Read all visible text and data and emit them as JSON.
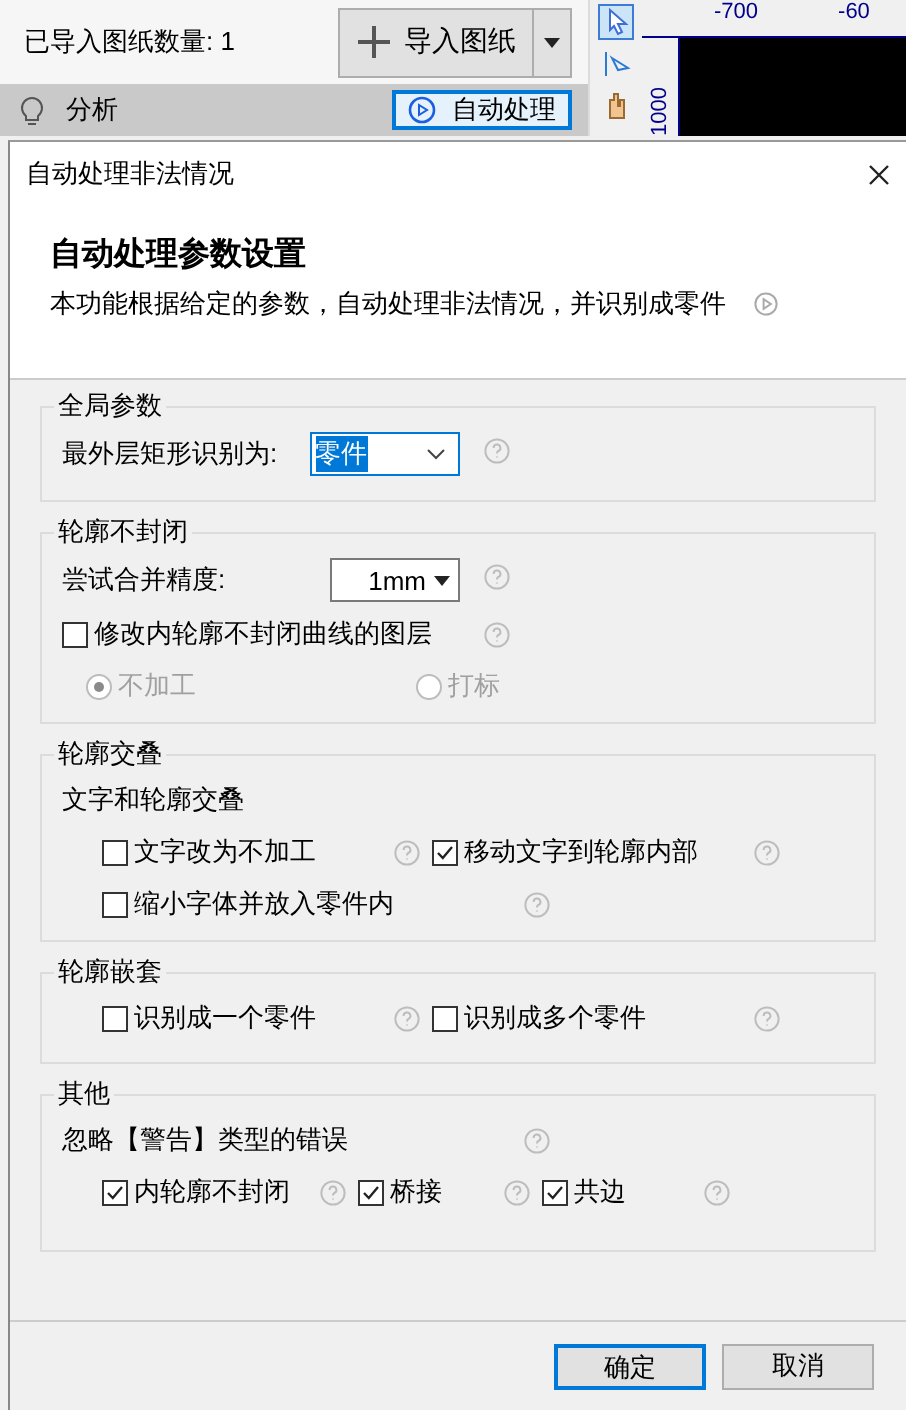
{
  "app": {
    "count_label": "已导入图纸数量: 1",
    "import_button": "导入图纸",
    "analysis_label": "分析",
    "auto_button": "自动处理",
    "ruler_x_labels": [
      "-700",
      "-60"
    ],
    "ruler_y_label": "1000"
  },
  "dialog": {
    "title": "自动处理非法情况",
    "heading": "自动处理参数设置",
    "description": "本功能根据给定的参数，自动处理非法情况，并识别成零件",
    "groups": [
      {
        "title": "全局参数",
        "rows": [
          {
            "kind": "single",
            "items": [
              {
                "kind": "select",
                "label": "最外层矩形识别为:",
                "value": "零件",
                "help": true
              }
            ]
          }
        ]
      },
      {
        "title": "轮廓不封闭",
        "rows": [
          {
            "kind": "single",
            "items": [
              {
                "kind": "combo",
                "label": "尝试合并精度:",
                "value": "1mm",
                "help": true
              }
            ]
          },
          {
            "kind": "single",
            "items": [
              {
                "kind": "checkbox",
                "label": "修改内轮廓不封闭曲线的图层",
                "checked": false,
                "help": true
              }
            ]
          },
          {
            "kind": "pair",
            "items": [
              {
                "kind": "radio",
                "label": "不加工",
                "selected": true,
                "disabled": true,
                "help": false
              },
              {
                "kind": "radio",
                "label": "打标",
                "selected": false,
                "disabled": true,
                "help": false
              }
            ]
          }
        ]
      },
      {
        "title": "轮廓交叠",
        "rows": [
          {
            "kind": "single",
            "items": [
              {
                "kind": "subheading",
                "label": "文字和轮廓交叠",
                "help": false
              }
            ]
          },
          {
            "kind": "pair",
            "items": [
              {
                "kind": "checkbox",
                "label": "文字改为不加工",
                "checked": false,
                "help": true
              },
              {
                "kind": "checkbox",
                "label": "移动文字到轮廓内部",
                "checked": true,
                "help": true
              }
            ]
          },
          {
            "kind": "single",
            "items": [
              {
                "kind": "checkbox",
                "label": "缩小字体并放入零件内",
                "checked": false,
                "help": true
              }
            ]
          }
        ]
      },
      {
        "title": "轮廓嵌套",
        "rows": [
          {
            "kind": "pair",
            "items": [
              {
                "kind": "checkbox",
                "label": "识别成一个零件",
                "checked": false,
                "help": true
              },
              {
                "kind": "checkbox",
                "label": "识别成多个零件",
                "checked": false,
                "help": true
              }
            ]
          }
        ]
      },
      {
        "title": "其他",
        "rows": [
          {
            "kind": "single",
            "items": [
              {
                "kind": "subheading",
                "label": "忽略【警告】类型的错误",
                "help": true
              }
            ]
          },
          {
            "kind": "triple",
            "items": [
              {
                "kind": "checkbox",
                "label": "内轮廓不封闭",
                "checked": true,
                "help": true
              },
              {
                "kind": "checkbox",
                "label": "桥接",
                "checked": true,
                "help": true
              },
              {
                "kind": "checkbox",
                "label": "共边",
                "checked": true,
                "help": true
              }
            ]
          }
        ]
      }
    ],
    "buttons": [
      {
        "label": "确定",
        "selected": true
      },
      {
        "label": "取消",
        "selected": false
      }
    ]
  }
}
